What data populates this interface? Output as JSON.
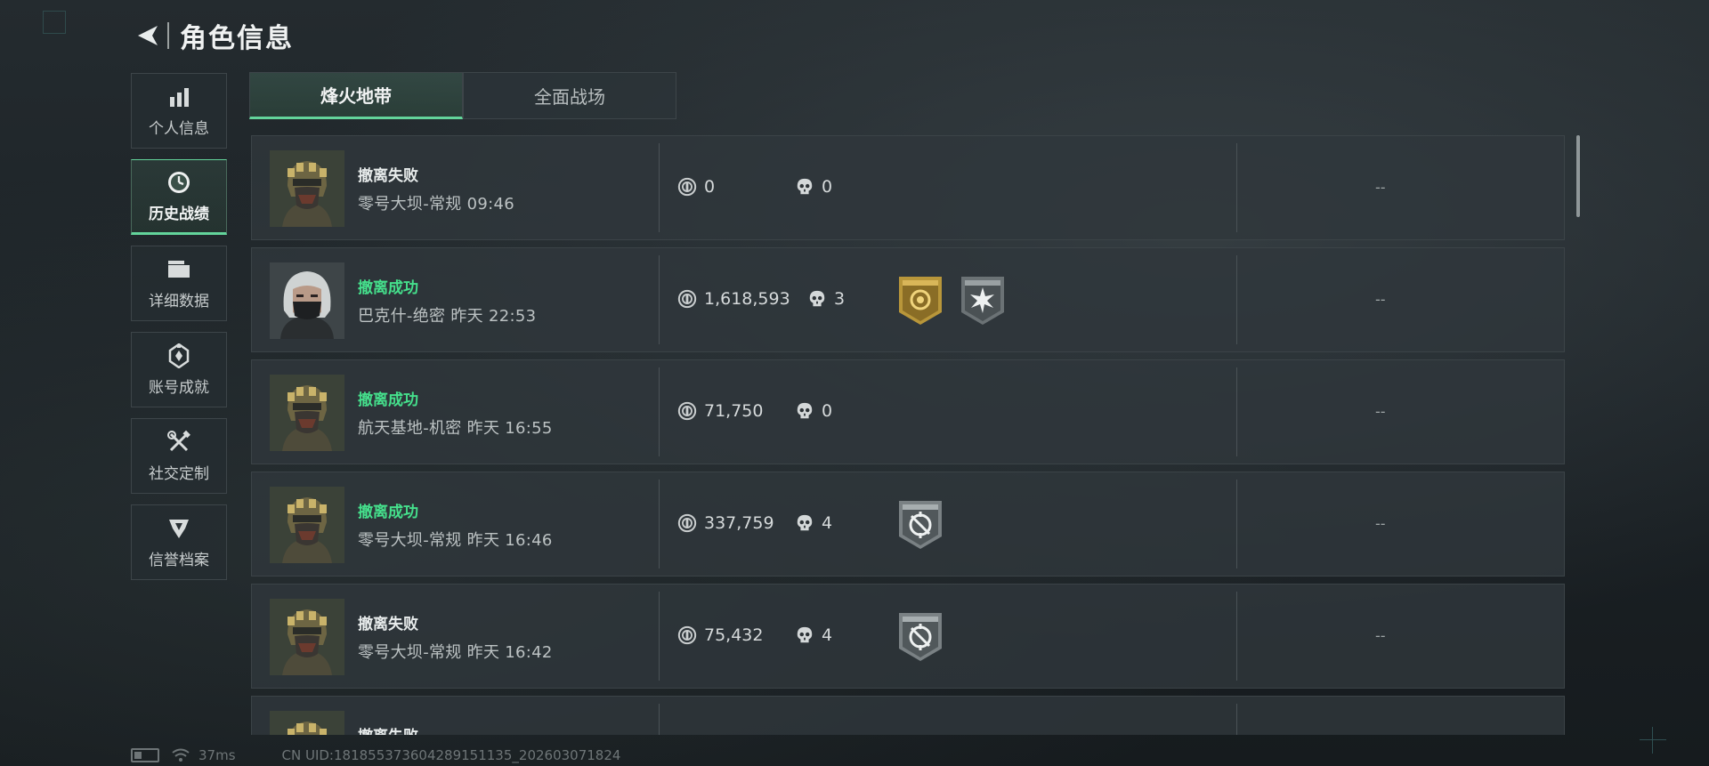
{
  "header": {
    "title": "角色信息",
    "back_icon": "back-arrow-icon"
  },
  "sidebar": {
    "items": [
      {
        "label": "个人信息",
        "icon": "bar-chart-icon",
        "active": false
      },
      {
        "label": "历史战绩",
        "icon": "clock-icon",
        "active": true
      },
      {
        "label": "详细数据",
        "icon": "folder-icon",
        "active": false
      },
      {
        "label": "账号成就",
        "icon": "achievement-icon",
        "active": false
      },
      {
        "label": "社交定制",
        "icon": "tools-icon",
        "active": false
      },
      {
        "label": "信誉档案",
        "icon": "credit-shield-icon",
        "active": false
      }
    ]
  },
  "tabs": [
    {
      "label": "烽火地带",
      "active": true
    },
    {
      "label": "全面战场",
      "active": false
    }
  ],
  "matches": [
    {
      "status": "撤离失败",
      "success": false,
      "map": "零号大坝-常规",
      "time": "09:46",
      "coins": "0",
      "kills": "0",
      "badges": [],
      "rating": "--",
      "avatar": "helmet-operator"
    },
    {
      "status": "撤离成功",
      "success": true,
      "map": "巴克什-绝密",
      "time": "昨天 22:53",
      "coins": "1,618,593",
      "kills": "3",
      "badges": [
        "gold-emblem-badge",
        "burst-badge"
      ],
      "rating": "--",
      "avatar": "white-hair-operator"
    },
    {
      "status": "撤离成功",
      "success": true,
      "map": "航天基地-机密",
      "time": "昨天 16:55",
      "coins": "71,750",
      "kills": "0",
      "badges": [],
      "rating": "--",
      "avatar": "helmet-operator"
    },
    {
      "status": "撤离成功",
      "success": true,
      "map": "零号大坝-常规",
      "time": "昨天 16:46",
      "coins": "337,759",
      "kills": "4",
      "badges": [
        "crosshair-badge"
      ],
      "rating": "--",
      "avatar": "helmet-operator"
    },
    {
      "status": "撤离失败",
      "success": false,
      "map": "零号大坝-常规",
      "time": "昨天 16:42",
      "coins": "75,432",
      "kills": "4",
      "badges": [
        "crosshair-badge"
      ],
      "rating": "--",
      "avatar": "helmet-operator"
    },
    {
      "status": "撤离失败",
      "success": false,
      "map": "",
      "time": "",
      "coins": "",
      "kills": "",
      "badges": [],
      "rating": "",
      "avatar": "helmet-operator"
    }
  ],
  "footer": {
    "ping": "37ms",
    "uid": "CN UID:181855373604289151135_202603071824"
  },
  "colors": {
    "accent": "#63d49b",
    "success": "#45e08c",
    "gold": "#b8963a"
  }
}
